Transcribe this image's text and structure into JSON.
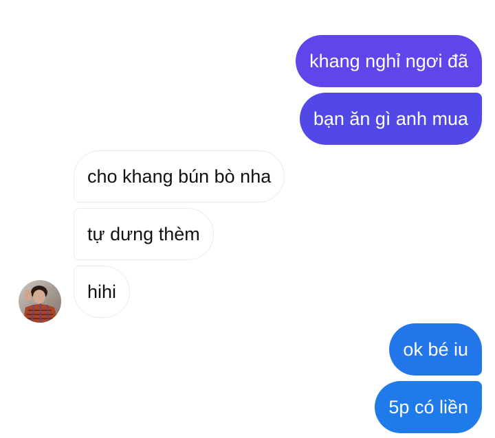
{
  "conversation": {
    "messages": [
      {
        "sender": "self",
        "text": "khang nghỉ ngơi đã"
      },
      {
        "sender": "self",
        "text": "bạn ăn gì anh mua"
      },
      {
        "sender": "contact",
        "text": "cho khang bún bò nha"
      },
      {
        "sender": "contact",
        "text": "tự dưng thèm"
      },
      {
        "sender": "contact",
        "text": "hihi"
      },
      {
        "sender": "self",
        "text": "ok bé iu"
      },
      {
        "sender": "self",
        "text": "5p có liền"
      }
    ]
  },
  "contact": {
    "avatar_icon": "profile-photo-avatar"
  },
  "colors": {
    "outgoing_top": "#6045ea",
    "outgoing_bottom": "#1f7bea",
    "incoming_border": "#ececec",
    "background": "#ffffff"
  }
}
